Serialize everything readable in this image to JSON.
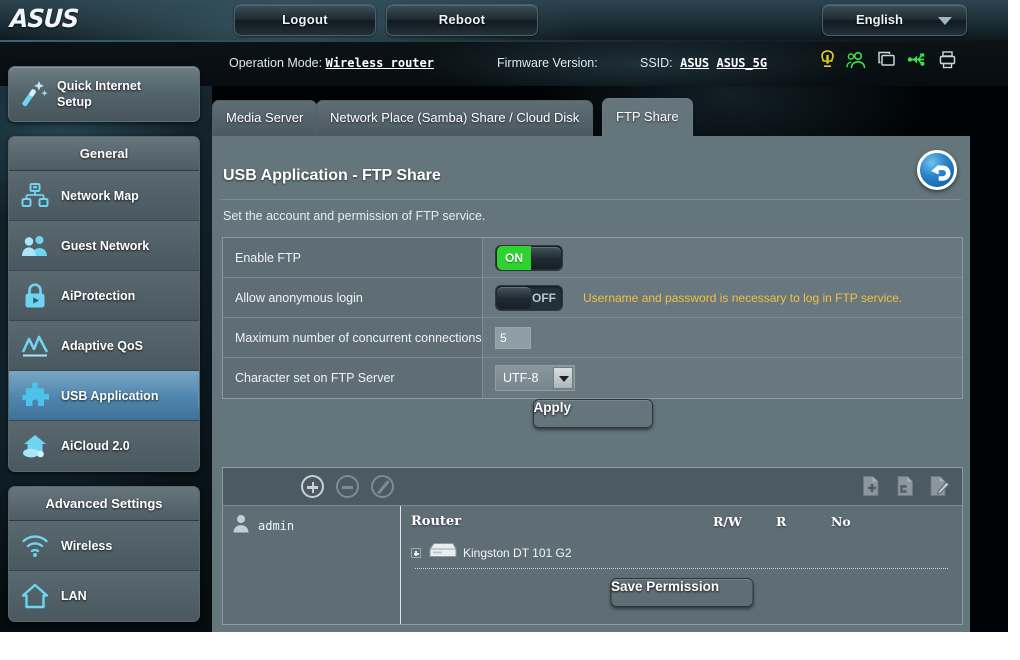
{
  "banner": {
    "logo_text": "ASUS",
    "logout_label": "Logout",
    "reboot_label": "Reboot",
    "language": "English"
  },
  "infobar": {
    "operation_mode_label": "Operation Mode:",
    "operation_mode_value": "Wireless router",
    "firmware_label": "Firmware Version:",
    "firmware_value": "",
    "ssid_label": "SSID:",
    "ssid_value_1": "ASUS",
    "ssid_value_2": "ASUS_5G",
    "icons": [
      "alert-icon",
      "guest-users-icon",
      "devices-icon",
      "usb-icon",
      "printer-icon"
    ]
  },
  "sidebar": {
    "quick_setup": {
      "line1": "Quick Internet",
      "line2": "Setup",
      "icon": "magic-wand-icon"
    },
    "groups": [
      {
        "title": "General",
        "items": [
          {
            "label": "Network Map",
            "icon": "network-map-icon",
            "active": false
          },
          {
            "label": "Guest Network",
            "icon": "guest-network-icon",
            "active": false
          },
          {
            "label": "AiProtection",
            "icon": "lock-shield-icon",
            "active": false
          },
          {
            "label": "Adaptive QoS",
            "icon": "qos-chart-icon",
            "active": false
          },
          {
            "label": "USB Application",
            "icon": "puzzle-piece-icon",
            "active": true
          },
          {
            "label": "AiCloud 2.0",
            "icon": "cloud-house-icon",
            "active": false
          }
        ]
      },
      {
        "title": "Advanced Settings",
        "items": [
          {
            "label": "Wireless",
            "icon": "wifi-icon",
            "active": false
          },
          {
            "label": "LAN",
            "icon": "house-icon",
            "active": false
          }
        ]
      }
    ]
  },
  "tabs": [
    {
      "label": "Media Server",
      "active": false
    },
    {
      "label": "Network Place (Samba) Share / Cloud Disk",
      "active": false
    },
    {
      "label": "FTP Share",
      "active": true
    }
  ],
  "page": {
    "title": "USB Application - FTP Share",
    "description": "Set the account and permission of FTP service.",
    "back_icon": "back-arrow-icon"
  },
  "settings": {
    "rows": [
      {
        "label": "Enable FTP",
        "control": "toggle",
        "state": "ON",
        "hint": ""
      },
      {
        "label": "Allow anonymous login",
        "control": "toggle",
        "state": "OFF",
        "hint": "Username and password is necessary to log in FTP service."
      },
      {
        "label": "Maximum number of concurrent connections",
        "control": "number",
        "value": "5",
        "hint": ""
      },
      {
        "label": "Character set on FTP Server",
        "control": "select",
        "value": "UTF-8",
        "hint": ""
      }
    ],
    "apply_label": "Apply"
  },
  "permission": {
    "toolbar": {
      "add_icon": "add-user-circle-icon",
      "remove_icon": "remove-user-circle-icon",
      "edit_icon": "edit-user-circle-icon",
      "right_icons": [
        "add-folder-icon",
        "folder-icon",
        "rename-folder-icon"
      ]
    },
    "users": [
      {
        "name": "admin",
        "icon": "user-avatar-icon"
      }
    ],
    "device_header": "Router",
    "columns": [
      "R/W",
      "R",
      "No"
    ],
    "devices": [
      {
        "name": "Kingston DT 101 G2",
        "icon": "usb-drive-icon",
        "expandable": true
      }
    ],
    "save_label": "Save Permission"
  },
  "colors": {
    "accent_blue": "#4f86ad",
    "toggle_on_green": "#2fd32f",
    "hint_yellow": "#f0c040",
    "panel_gray": "#65757c"
  }
}
